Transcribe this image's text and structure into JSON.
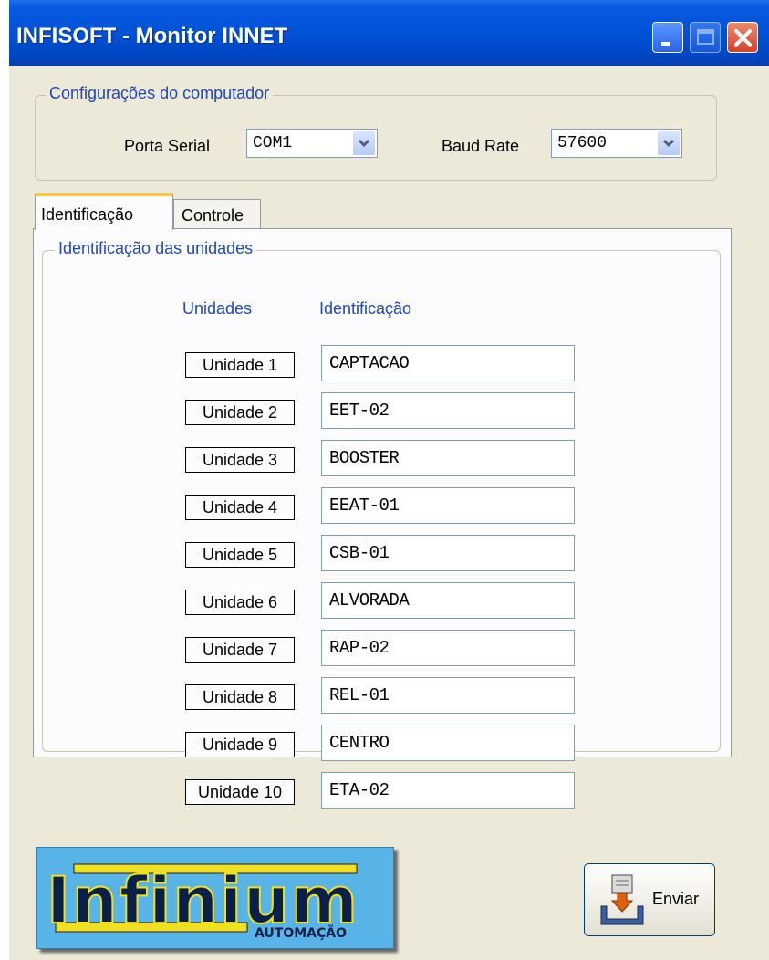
{
  "window": {
    "title": "INFISOFT - Monitor INNET"
  },
  "config": {
    "legend": "Configurações do computador",
    "serial_label": "Porta Serial",
    "serial_value": "COM1",
    "baud_label": "Baud Rate",
    "baud_value": "57600"
  },
  "tabs": [
    {
      "label": "Identificação",
      "active": true
    },
    {
      "label": "Controle",
      "active": false
    }
  ],
  "identification": {
    "legend": "Identificação das unidades",
    "col_units": "Unidades",
    "col_ident": "Identificação",
    "rows": [
      {
        "unit": "Unidade 1",
        "ident": "CAPTACAO"
      },
      {
        "unit": "Unidade 2",
        "ident": "EET-02"
      },
      {
        "unit": "Unidade 3",
        "ident": "BOOSTER"
      },
      {
        "unit": "Unidade 4",
        "ident": "EEAT-01"
      },
      {
        "unit": "Unidade 5",
        "ident": "CSB-01"
      },
      {
        "unit": "Unidade 6",
        "ident": "ALVORADA"
      },
      {
        "unit": "Unidade 7",
        "ident": "RAP-02"
      },
      {
        "unit": "Unidade 8",
        "ident": "REL-01"
      },
      {
        "unit": "Unidade 9",
        "ident": "CENTRO"
      },
      {
        "unit": "Unidade 10",
        "ident": "ETA-02"
      }
    ]
  },
  "logo": {
    "word": "Infinium",
    "sub": "AUTOMAÇÃO"
  },
  "buttons": {
    "send_label": "Enviar"
  },
  "colors": {
    "titlebar": "#0052d6",
    "accent_text": "#1f48b8",
    "logo_bg": "#58b4e6",
    "logo_bar": "#f0e020"
  }
}
